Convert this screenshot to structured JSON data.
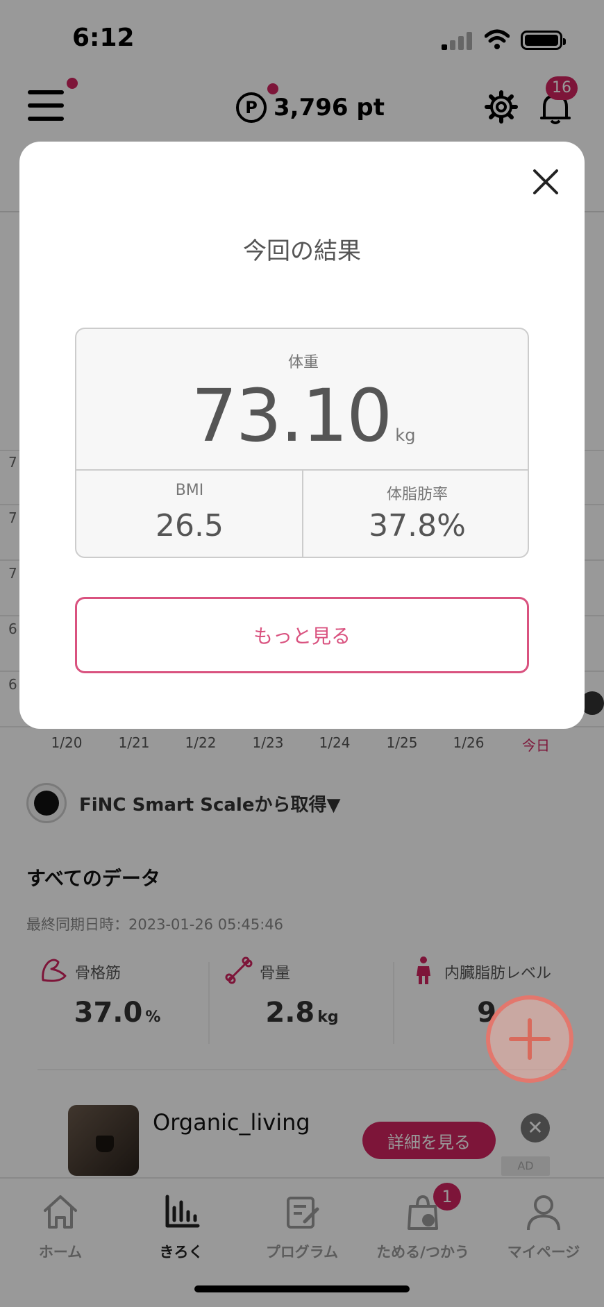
{
  "status_bar": {
    "time": "6:12"
  },
  "header": {
    "points_symbol": "P",
    "points_value": "3,796 pt",
    "notifications": "16"
  },
  "chart": {
    "y_ticks": [
      "7",
      "7",
      "7",
      "6",
      "6"
    ],
    "x_ticks": [
      "1/20",
      "1/21",
      "1/22",
      "1/23",
      "1/24",
      "1/25",
      "1/26",
      "今日"
    ],
    "today_color": "#d0245f"
  },
  "source": {
    "label": "FiNC Smart Scaleから取得▼"
  },
  "all_data": {
    "title": "すべてのデータ",
    "last_sync": "最終同期日時：2023-01-26 05:45:46",
    "metrics": [
      {
        "label": "骨格筋",
        "value": "37.0",
        "unit": "%",
        "icon": "muscle-icon"
      },
      {
        "label": "骨量",
        "value": "2.8",
        "unit": "kg",
        "icon": "bone-icon"
      },
      {
        "label": "内臓脂肪レベル",
        "value": "9",
        "unit": "",
        "icon": "body-icon"
      }
    ]
  },
  "ad": {
    "title": "Organic_living",
    "button": "詳細を見る",
    "close": "✕",
    "label": "AD"
  },
  "nav": {
    "items": [
      {
        "label": "ホーム",
        "icon": "home-icon"
      },
      {
        "label": "きろく",
        "icon": "chart-icon"
      },
      {
        "label": "プログラム",
        "icon": "program-icon"
      },
      {
        "label": "ためる/つかう",
        "icon": "points-bag-icon"
      },
      {
        "label": "マイページ",
        "icon": "person-icon"
      }
    ],
    "active_index": 1,
    "points_badge": "1"
  },
  "modal": {
    "title": "今回の結果",
    "weight_label": "体重",
    "weight_value": "73.10",
    "weight_unit": "kg",
    "bmi_label": "BMI",
    "bmi_value": "26.5",
    "fat_label": "体脂肪率",
    "fat_value": "37.8%",
    "more_button": "もっと見る"
  },
  "colors": {
    "accent": "#d0245f",
    "button_outline": "#d9527f"
  }
}
